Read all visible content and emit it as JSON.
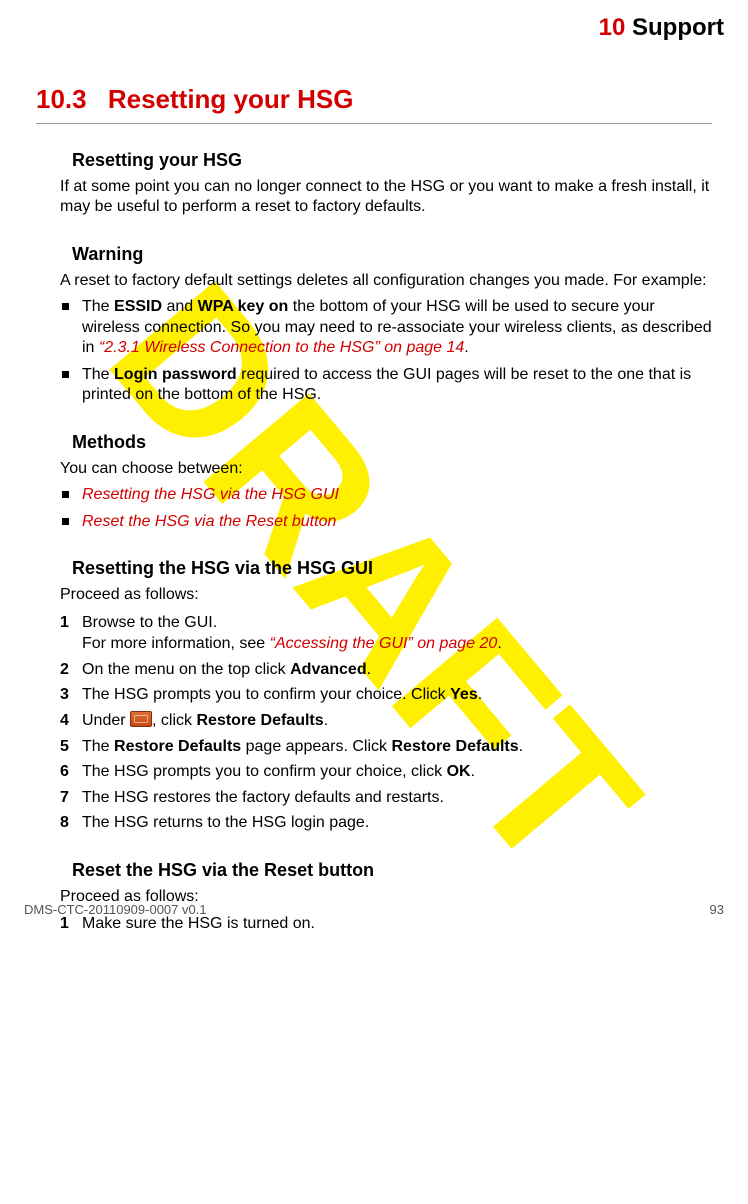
{
  "header": {
    "chapter_num": "10",
    "chapter_title": "Support"
  },
  "section": {
    "number": "10.3",
    "title": "Resetting your HSG"
  },
  "sub1": {
    "heading": "Resetting your HSG",
    "para": "If at some point you can no longer connect to the HSG or you want to make a fresh install, it may be useful to perform a reset to factory defaults."
  },
  "warning": {
    "heading": "Warning",
    "para": "A reset to factory default settings deletes all configuration changes you made. For example:",
    "b1_pre": "The ",
    "b1_bold1": "ESSID",
    "b1_mid1": " and ",
    "b1_bold2": "WPA key on",
    "b1_mid2": " the bottom of your HSG will be used to secure your wireless connection. So you may need to re-associate your wireless clients, as described in ",
    "b1_link": "“2.3.1 Wireless Connection to the HSG” on page 14",
    "b1_end": ".",
    "b2_pre": "The ",
    "b2_bold": "Login password",
    "b2_post": " required to access the GUI pages will be reset to the one that is printed on the bottom of the HSG."
  },
  "methods": {
    "heading": "Methods",
    "para": "You can choose between:",
    "link1": "Resetting the HSG via the HSG GUI",
    "link2": "Reset the HSG via the Reset button"
  },
  "gui": {
    "heading": "Resetting the HSG via the HSG GUI",
    "para": "Proceed as follows:",
    "s1a": "Browse to the GUI.",
    "s1b_pre": "For more information, see ",
    "s1b_link": "“Accessing the GUI” on page 20",
    "s1b_end": ".",
    "s2_pre": "On the menu on the top click ",
    "s2_bold": "Advanced",
    "s2_end": ".",
    "s3_pre": "The HSG prompts you to confirm your choice. Click ",
    "s3_bold": "Yes",
    "s3_end": ".",
    "s4_pre": "Under ",
    "s4_mid": ", click ",
    "s4_bold": "Restore Defaults",
    "s4_end": ".",
    "s5_pre": "The ",
    "s5_bold1": "Restore Defaults",
    "s5_mid": " page appears. Click ",
    "s5_bold2": "Restore Defaults",
    "s5_end": ".",
    "s6_pre": "The HSG prompts you to confirm your choice, click ",
    "s6_bold": "OK",
    "s6_end": ".",
    "s7": "The HSG restores the factory defaults and restarts.",
    "s8": "The HSG returns to the HSG login page."
  },
  "reset_button": {
    "heading": "Reset the HSG via the Reset button",
    "para": "Proceed as follows:",
    "s1": "Make sure the HSG is turned on."
  },
  "footer": {
    "docid": "DMS-CTC-20110909-0007 v0.1",
    "pagenum": "93"
  },
  "watermark": "DRAFT"
}
